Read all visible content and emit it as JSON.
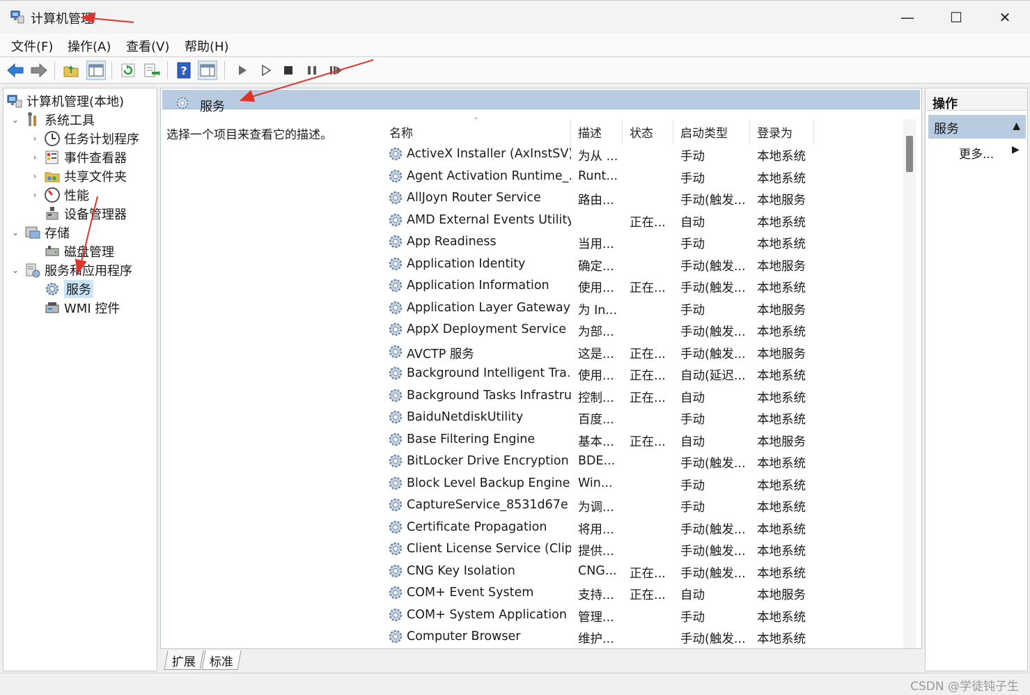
{
  "window": {
    "title": "计算机管理",
    "controls": {
      "minimize": "—",
      "maximize": "☐",
      "close": "✕"
    }
  },
  "menu": [
    "文件(F)",
    "操作(A)",
    "查看(V)",
    "帮助(H)"
  ],
  "tree": {
    "root": "计算机管理(本地)",
    "system_tools": "系统工具",
    "task_scheduler": "任务计划程序",
    "event_viewer": "事件查看器",
    "shared_folders": "共享文件夹",
    "performance": "性能",
    "device_manager": "设备管理器",
    "storage": "存储",
    "disk_management": "磁盘管理",
    "services_apps": "服务和应用程序",
    "services": "服务",
    "wmi": "WMI 控件"
  },
  "center": {
    "header_title": "服务",
    "description_hint": "选择一个项目来查看它的描述。",
    "columns": {
      "name": "名称",
      "desc": "描述",
      "status": "状态",
      "startup": "启动类型",
      "logon": "登录为"
    },
    "services": [
      {
        "name": "ActiveX Installer (AxInstSV)",
        "desc": "为从 ...",
        "status": "",
        "startup": "手动",
        "logon": "本地系统"
      },
      {
        "name": "Agent Activation Runtime_...",
        "desc": "Runt...",
        "status": "",
        "startup": "手动",
        "logon": "本地系统"
      },
      {
        "name": "AllJoyn Router Service",
        "desc": "路由...",
        "status": "",
        "startup": "手动(触发...",
        "logon": "本地服务"
      },
      {
        "name": "AMD External Events Utility",
        "desc": "",
        "status": "正在...",
        "startup": "自动",
        "logon": "本地系统"
      },
      {
        "name": "App Readiness",
        "desc": "当用...",
        "status": "",
        "startup": "手动",
        "logon": "本地系统"
      },
      {
        "name": "Application Identity",
        "desc": "确定...",
        "status": "",
        "startup": "手动(触发...",
        "logon": "本地服务"
      },
      {
        "name": "Application Information",
        "desc": "使用...",
        "status": "正在...",
        "startup": "手动(触发...",
        "logon": "本地系统"
      },
      {
        "name": "Application Layer Gateway ...",
        "desc": "为 In...",
        "status": "",
        "startup": "手动",
        "logon": "本地服务"
      },
      {
        "name": "AppX Deployment Service ...",
        "desc": "为部...",
        "status": "",
        "startup": "手动(触发...",
        "logon": "本地系统"
      },
      {
        "name": "AVCTP 服务",
        "desc": "这是...",
        "status": "正在...",
        "startup": "手动(触发...",
        "logon": "本地服务"
      },
      {
        "name": "Background Intelligent Tra...",
        "desc": "使用...",
        "status": "正在...",
        "startup": "自动(延迟...",
        "logon": "本地系统"
      },
      {
        "name": "Background Tasks Infrastru...",
        "desc": "控制...",
        "status": "正在...",
        "startup": "自动",
        "logon": "本地系统"
      },
      {
        "name": "BaiduNetdiskUtility",
        "desc": "百度...",
        "status": "",
        "startup": "手动",
        "logon": "本地系统"
      },
      {
        "name": "Base Filtering Engine",
        "desc": "基本...",
        "status": "正在...",
        "startup": "自动",
        "logon": "本地服务"
      },
      {
        "name": "BitLocker Drive Encryption ...",
        "desc": "BDE...",
        "status": "",
        "startup": "手动(触发...",
        "logon": "本地系统"
      },
      {
        "name": "Block Level Backup Engine ...",
        "desc": "Win...",
        "status": "",
        "startup": "手动",
        "logon": "本地系统"
      },
      {
        "name": "CaptureService_8531d67e",
        "desc": "为调...",
        "status": "",
        "startup": "手动",
        "logon": "本地系统"
      },
      {
        "name": "Certificate Propagation",
        "desc": "将用...",
        "status": "",
        "startup": "手动(触发...",
        "logon": "本地系统"
      },
      {
        "name": "Client License Service (Clip...",
        "desc": "提供...",
        "status": "",
        "startup": "手动(触发...",
        "logon": "本地系统"
      },
      {
        "name": "CNG Key Isolation",
        "desc": "CNG...",
        "status": "正在...",
        "startup": "手动(触发...",
        "logon": "本地系统"
      },
      {
        "name": "COM+ Event System",
        "desc": "支持...",
        "status": "正在...",
        "startup": "自动",
        "logon": "本地服务"
      },
      {
        "name": "COM+ System Application",
        "desc": "管理...",
        "status": "",
        "startup": "手动",
        "logon": "本地系统"
      },
      {
        "name": "Computer Browser",
        "desc": "维护...",
        "status": "",
        "startup": "手动(触发...",
        "logon": "本地系统"
      }
    ]
  },
  "tabs": [
    "扩展",
    "标准"
  ],
  "actions": {
    "title": "操作",
    "section": "服务",
    "more": "更多..."
  },
  "watermark": "CSDN @学徒钝子生",
  "colors": {
    "header_blue": "#b9cbe0",
    "selected": "#cce4f7",
    "arrow_red": "#e0332a"
  }
}
